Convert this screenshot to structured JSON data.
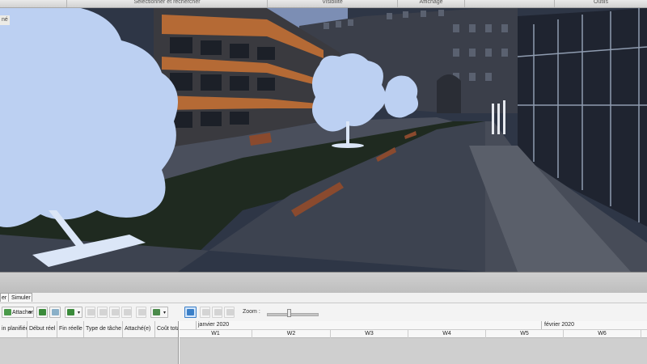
{
  "ribbon": {
    "groups": [
      {
        "label": ""
      },
      {
        "label": "Sélectionner et rechercher"
      },
      {
        "label": "Visibilité"
      },
      {
        "label": "Affichage"
      },
      {
        "label": ""
      },
      {
        "label": "Outils"
      }
    ]
  },
  "viewport": {
    "label": "né"
  },
  "timeliner": {
    "tabs": [
      "er",
      "Simuler"
    ],
    "toolbar": {
      "attach_label": "Attacher",
      "zoom_label": "Zoom :",
      "zoom_level": 0.45
    },
    "columns": [
      "in planifiée",
      "Début réel",
      "Fin réelle",
      "Type de tâche",
      "Attaché(e)",
      "Coût tota"
    ],
    "months": [
      "janvier 2020",
      "février 2020"
    ],
    "weeks": [
      "W1",
      "W2",
      "W3",
      "W4",
      "W5",
      "W6"
    ]
  },
  "colors": {
    "accent": "#3a7fc8",
    "building_orange": "#b56a35",
    "tree": "#bcd0f2"
  }
}
